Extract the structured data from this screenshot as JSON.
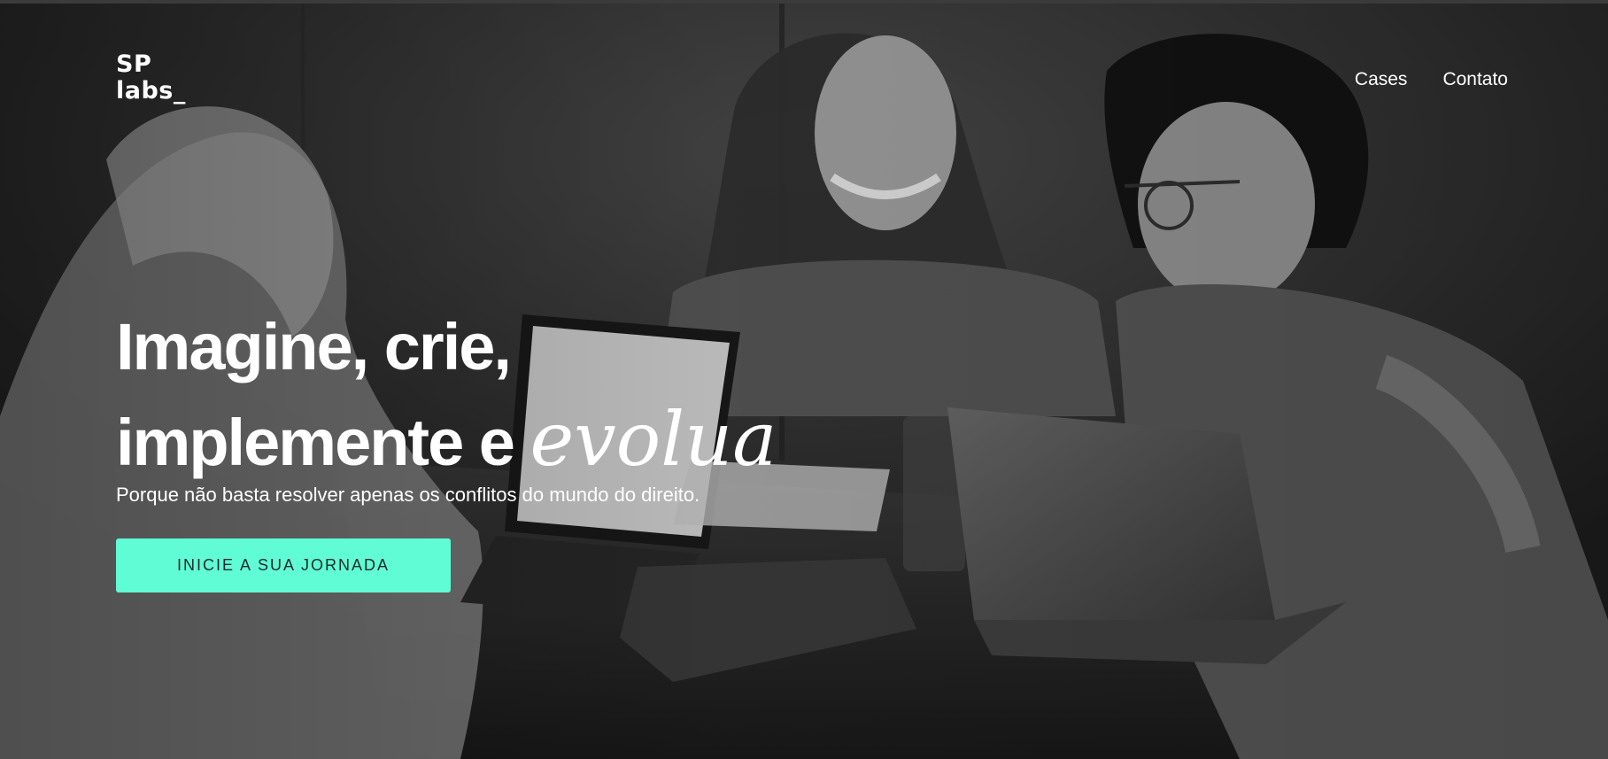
{
  "brand": {
    "logo_line1": "SP",
    "logo_line2": "labs_"
  },
  "nav": {
    "items": [
      {
        "label": "Cases"
      },
      {
        "label": "Contato"
      }
    ]
  },
  "hero": {
    "headline_line1": "Imagine, crie,",
    "headline_line2_prefix": "implemente e",
    "headline_accent": "evolua",
    "subtitle": "Porque não basta resolver apenas os conflitos do mundo do direito.",
    "cta_label": "INICIE A SUA JORNADA"
  },
  "colors": {
    "accent": "#5ffcd5",
    "text": "#ffffff",
    "overlay": "#1c1c1c"
  }
}
